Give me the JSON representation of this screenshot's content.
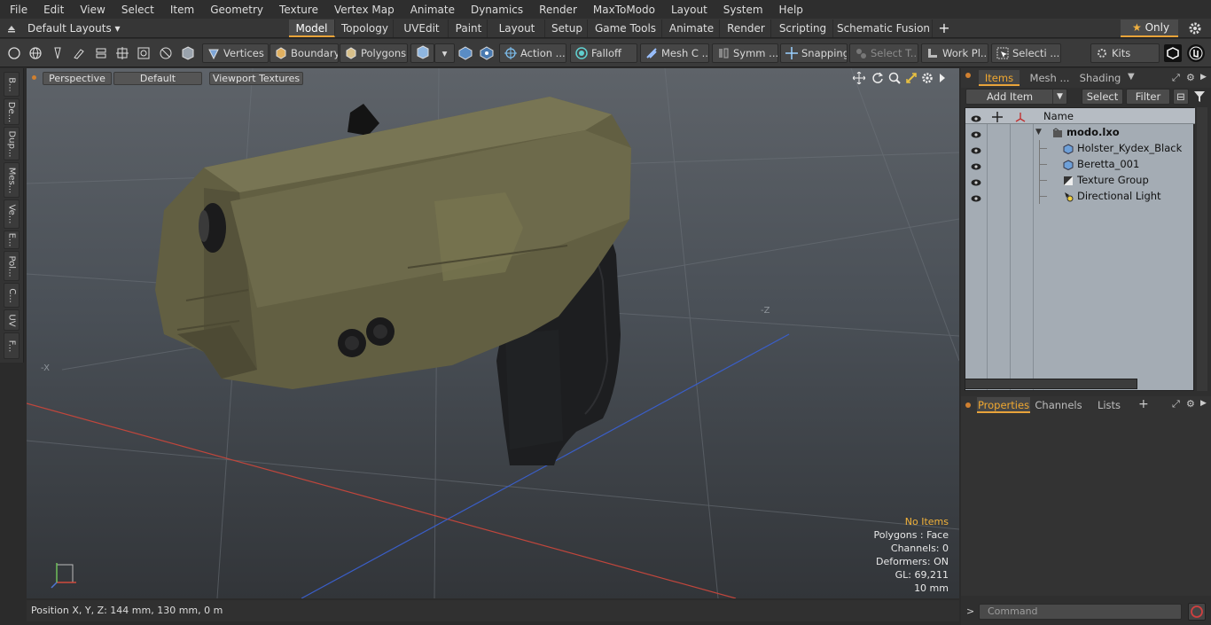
{
  "menu": [
    "File",
    "Edit",
    "View",
    "Select",
    "Item",
    "Geometry",
    "Texture",
    "Vertex Map",
    "Animate",
    "Dynamics",
    "Render",
    "MaxToModo",
    "Layout",
    "System",
    "Help"
  ],
  "layout_selector": "Default Layouts",
  "mode_tabs": [
    "Model",
    "Topology",
    "UVEdit",
    "Paint",
    "Layout",
    "Setup",
    "Game Tools",
    "Animate",
    "Render",
    "Scripting",
    "Schematic Fusion"
  ],
  "active_tab": "Model",
  "only_label": "Only",
  "toolbar": {
    "vertices": "Vertices",
    "boundary": "Boundary",
    "polygons": "Polygons",
    "action": "Action ...",
    "falloff": "Falloff",
    "mesh": "Mesh C ...",
    "symmetry": "Symm ...",
    "snapping": "Snapping",
    "select_t": "Select T...",
    "workplane": "Work Pl...",
    "selection": "Selecti ...",
    "kits": "Kits"
  },
  "left_tabs": [
    "B...",
    "De...",
    "Dup...",
    "Mes...",
    "Ve...",
    "E...",
    "Pol...",
    "C...",
    "UV",
    "F..."
  ],
  "viewport": {
    "view": "Perspective",
    "shading": "Default",
    "textures": "Viewport Textures",
    "axis_minus_z": "-Z",
    "axis_minus_x": "-X",
    "info": {
      "selection": "No Items",
      "polygons": "Polygons : Face",
      "channels": "Channels: 0",
      "deformers": "Deformers: ON",
      "gl": "GL: 69,211",
      "scale": "10 mm"
    }
  },
  "status": "Position X, Y, Z:   144 mm, 130 mm, 0 m",
  "items_panel": {
    "tabs": [
      "Items",
      "Mesh ...",
      "Shading"
    ],
    "add_item": "Add Item",
    "select": "Select",
    "filter": "Filter",
    "name_header": "Name",
    "items": [
      {
        "name": "modo.lxo",
        "icon": "scene-icon",
        "level": 0
      },
      {
        "name": "Holster_Kydex_Black",
        "icon": "mesh-icon",
        "level": 1
      },
      {
        "name": "Beretta_001",
        "icon": "mesh-icon",
        "level": 1
      },
      {
        "name": "Texture Group",
        "icon": "texture-group-icon",
        "level": 1
      },
      {
        "name": "Directional Light",
        "icon": "light-icon",
        "level": 1
      }
    ]
  },
  "properties_panel": {
    "tabs": [
      "Properties",
      "Channels",
      "Lists"
    ]
  },
  "command_placeholder": "Command",
  "colors": {
    "accent": "#e8a33a",
    "viewport_top": "#5e6369",
    "holster": "#6a6748",
    "gun": "#1e1f21"
  }
}
